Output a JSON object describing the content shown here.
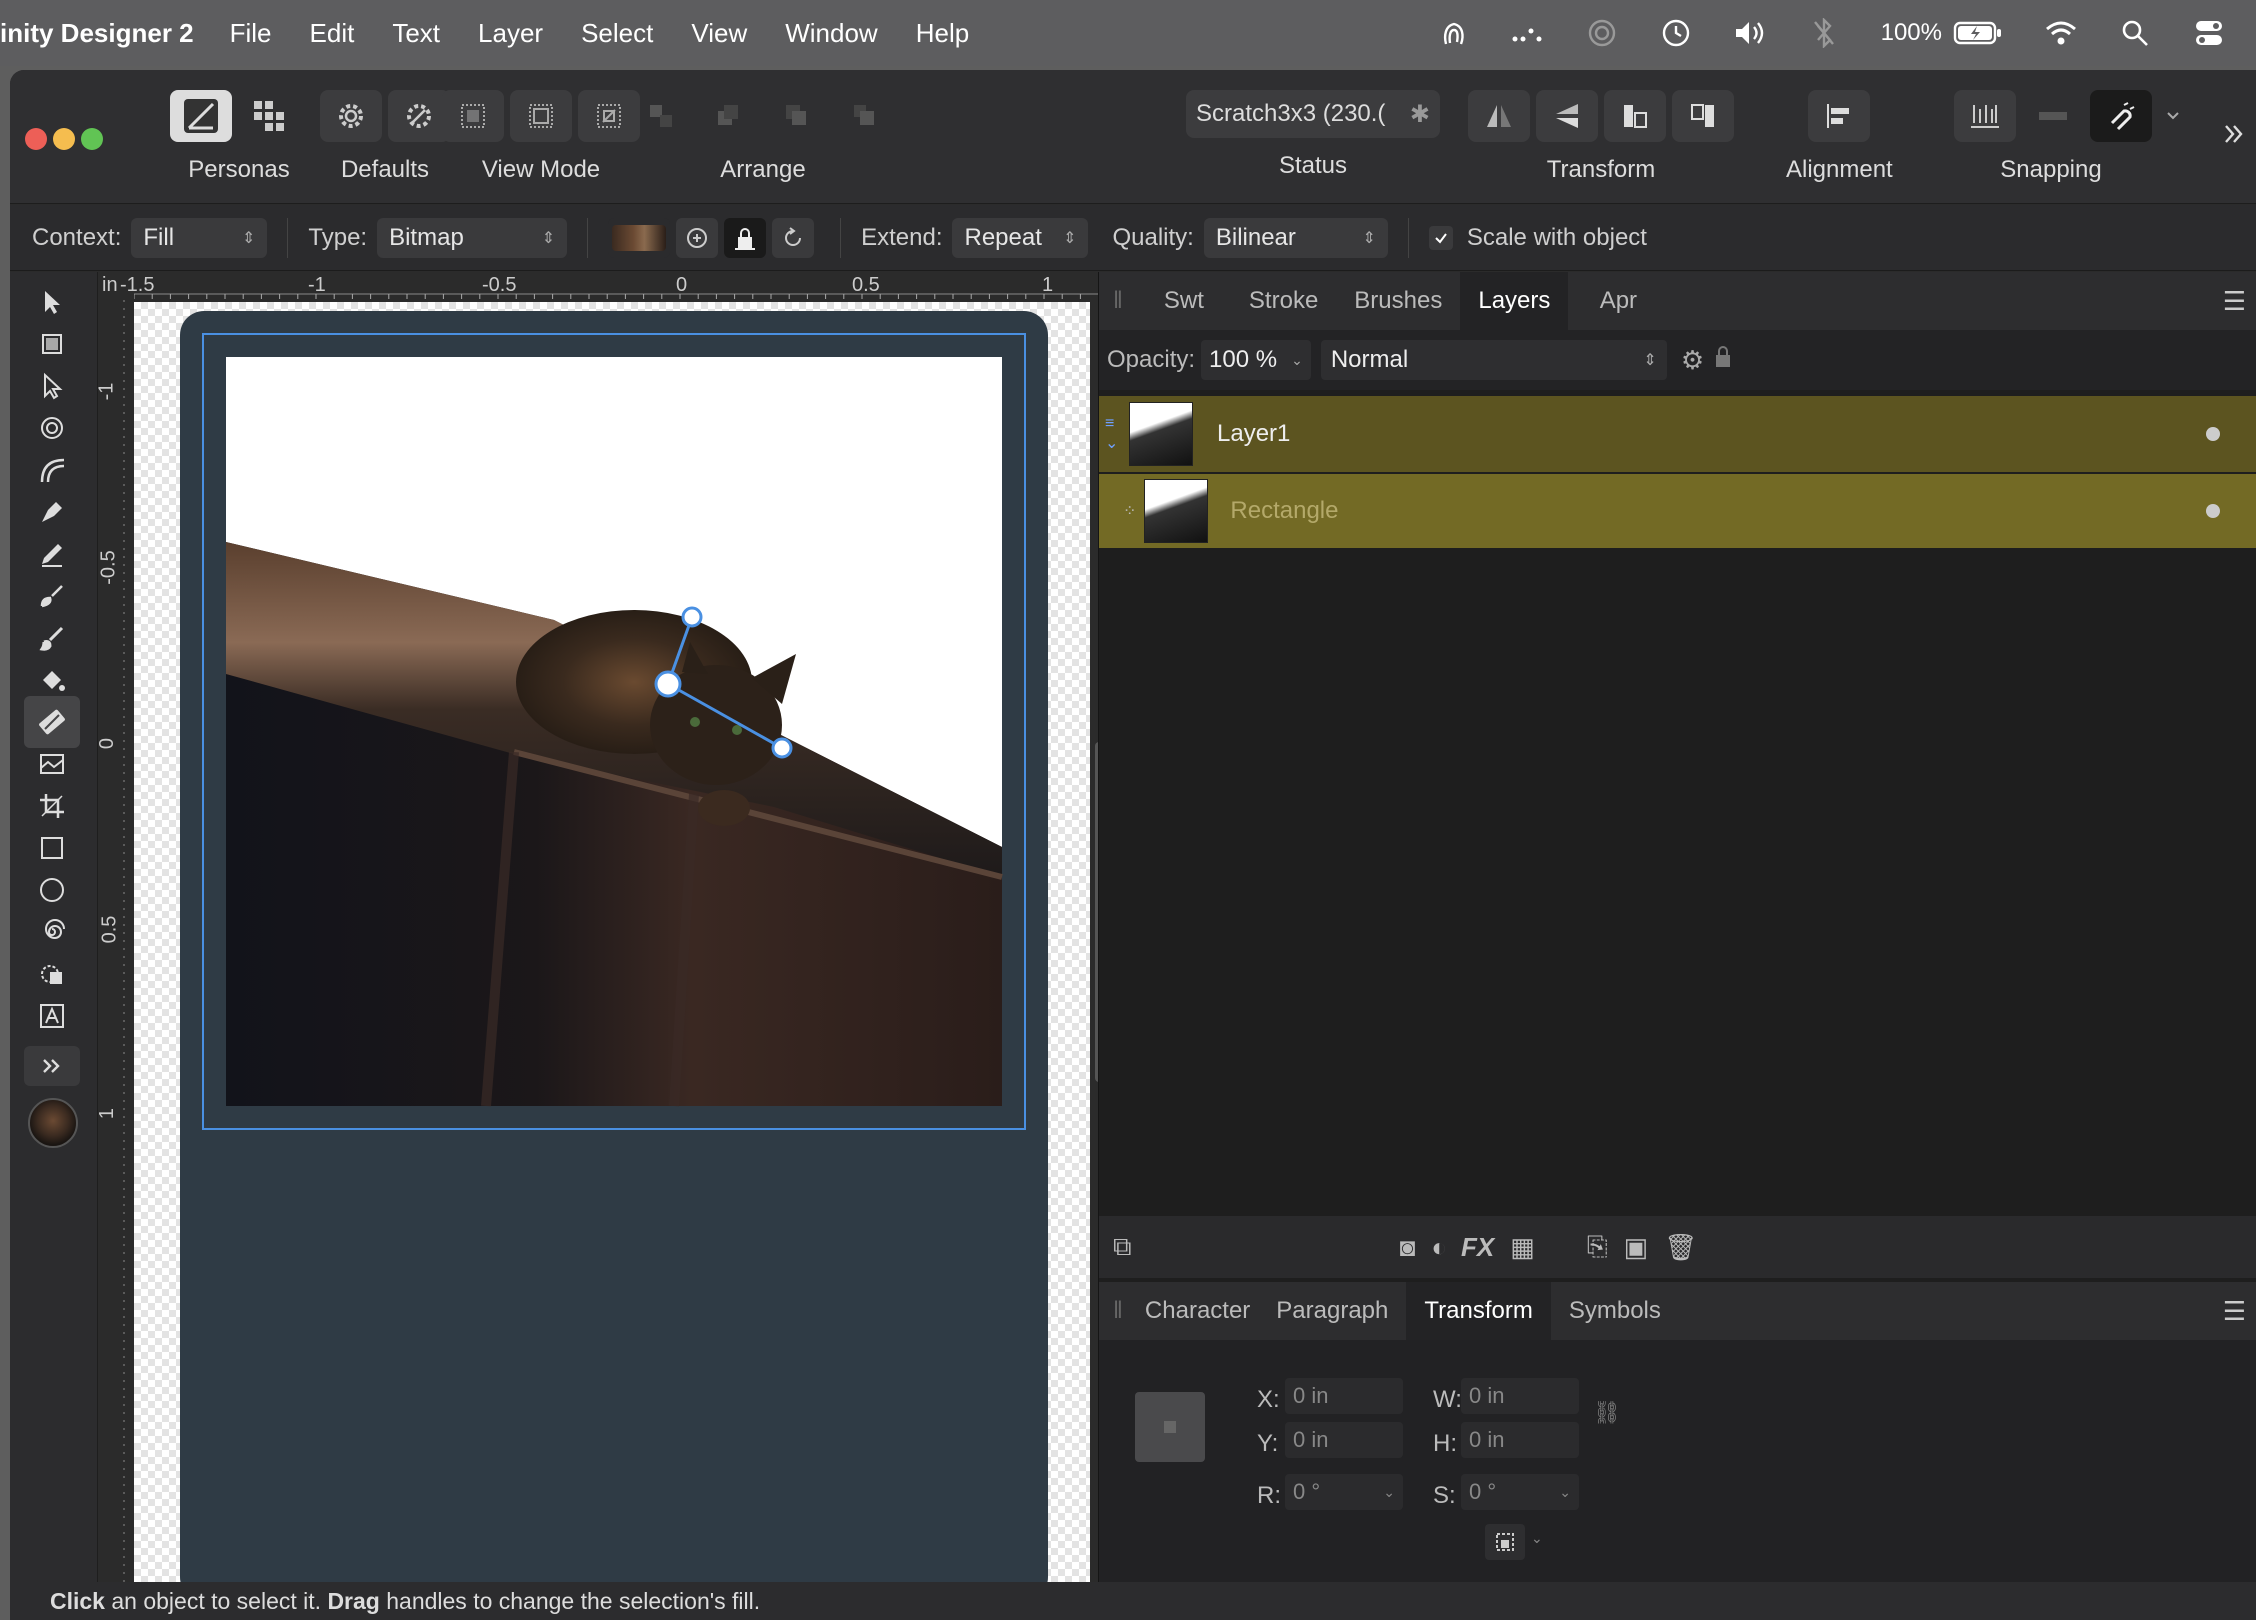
{
  "menubar": {
    "app_name": "inity Designer 2",
    "items": [
      "File",
      "Edit",
      "Text",
      "Layer",
      "Select",
      "View",
      "Window",
      "Help"
    ],
    "battery": "100%"
  },
  "toolbar": {
    "personas_label": "Personas",
    "defaults_label": "Defaults",
    "view_mode_label": "View Mode",
    "arrange_label": "Arrange",
    "status_label": "Status",
    "status_value": "Scratch3x3 (230.(",
    "transform_label": "Transform",
    "alignment_label": "Alignment",
    "snapping_label": "Snapping"
  },
  "context": {
    "context_label": "Context:",
    "context_value": "Fill",
    "type_label": "Type:",
    "type_value": "Bitmap",
    "extend_label": "Extend:",
    "extend_value": "Repeat",
    "quality_label": "Quality:",
    "quality_value": "Bilinear",
    "scale_with_object": "Scale with object",
    "scale_checked": true
  },
  "rulers": {
    "unit": "in",
    "h_ticks": [
      "-1.5",
      "-1",
      "-0.5",
      "0",
      "0.5",
      "1"
    ],
    "v_ticks": [
      "-1",
      "-0.5",
      "0",
      "0.5",
      "1"
    ]
  },
  "layers_panel": {
    "tabs": [
      "Swt",
      "Stroke",
      "Brushes",
      "Layers",
      "Apr"
    ],
    "active_tab": "Layers",
    "opacity_label": "Opacity:",
    "opacity_value": "100 %",
    "blend_mode": "Normal",
    "layers": [
      {
        "name": "Layer1",
        "selected": true
      },
      {
        "name": "Rectangle",
        "selected": true
      }
    ]
  },
  "transform_panel": {
    "tabs": [
      "Character",
      "Paragraph",
      "Transform",
      "Symbols"
    ],
    "active_tab": "Transform",
    "x_label": "X:",
    "x_value": "0 in",
    "y_label": "Y:",
    "y_value": "0 in",
    "w_label": "W:",
    "w_value": "0 in",
    "h_label": "H:",
    "h_value": "0 in",
    "r_label": "R:",
    "r_value": "0 °",
    "s_label": "S:",
    "s_value": "0 °"
  },
  "status_bar": {
    "b1": "Click",
    "t1": " an object to select it. ",
    "b2": "Drag",
    "t2": " handles to change the selection's fill."
  },
  "colors": {
    "accent": "#4a90e2",
    "layer_selected": "#5c5420",
    "layer_selected_child": "#736a25",
    "frame": "#2e3a44"
  }
}
